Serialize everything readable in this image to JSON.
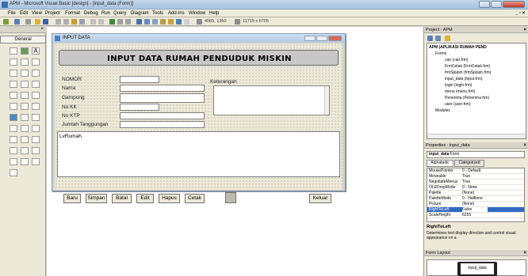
{
  "window": {
    "title": "APM - Microsoft Visual Basic [design] - [input_data (Form)]"
  },
  "menu": [
    "File",
    "Edit",
    "View",
    "Project",
    "Format",
    "Debug",
    "Run",
    "Query",
    "Diagram",
    "Tools",
    "Add-Ins",
    "Window",
    "Help"
  ],
  "toolbar": {
    "position": "4065, 1350",
    "size": "11715 x 6705"
  },
  "toolbox": {
    "label": "General"
  },
  "form": {
    "caption": "INPUT DATA",
    "header": "INPUT DATA RUMAH PENDUDUK MISKIN",
    "labels": {
      "nomor": "NOMOR",
      "nama": "Nama",
      "gampong": "Gampong",
      "nokk": "No KK",
      "noktp": "No KTP",
      "jumlah": "Jumlah Tanggungan",
      "keterangan": "Keterangan"
    },
    "listview": "LvRumah",
    "buttons": {
      "baru": "Baru",
      "simpan": "Simpan",
      "batal": "Batal",
      "edit": "Edit",
      "hapus": "Hapus",
      "cetak": "Cetak",
      "keluar": "Keluar"
    }
  },
  "project": {
    "title": "Project - APM",
    "root": "APM (APLIKASI RUMAH PEND",
    "forms_folder": "Forms",
    "items": [
      "cari (cari.frm)",
      "FrmCetak (FrmCetak.frm)",
      "frmSplash (frmSplash.frm)",
      "input_data (input.frm)",
      "login (login.frm)",
      "menu (menu.frm)",
      "Penerima (Penerima.frm)",
      "user (user.frm)"
    ],
    "modules_folder": "Modules"
  },
  "properties": {
    "title": "Properties - input_data",
    "object": "input_data",
    "object_type": "Form",
    "tabs": [
      "Alphabetic",
      "Categorized"
    ],
    "rows": [
      {
        "k": "MousePointer",
        "v": "0 - Default"
      },
      {
        "k": "Moveable",
        "v": "True"
      },
      {
        "k": "NegotiateMenus",
        "v": "True"
      },
      {
        "k": "OLEDropMode",
        "v": "0 - None"
      },
      {
        "k": "Palette",
        "v": "(None)"
      },
      {
        "k": "PaletteMode",
        "v": "0 - Halftone"
      },
      {
        "k": "Picture",
        "v": "(None)"
      },
      {
        "k": "RightToLeft",
        "v": "False"
      },
      {
        "k": "ScaleHeight",
        "v": "6255"
      }
    ],
    "desc_title": "RightToLeft",
    "desc_text": "Determines text display direction and control visual appearance on a"
  },
  "formlayout": {
    "title": "Form Layout",
    "form": "input_data"
  },
  "colors": {
    "title_blue": "#3a6fb0",
    "selection": "#316ac5"
  }
}
